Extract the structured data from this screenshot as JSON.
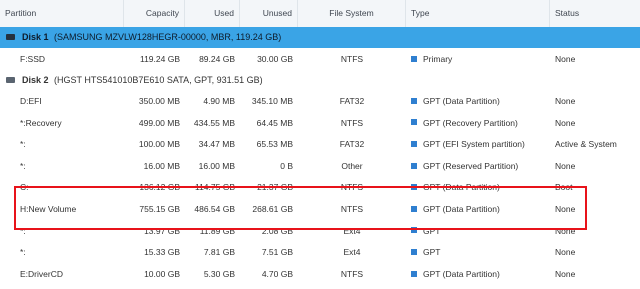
{
  "columns": {
    "partition": "Partition",
    "capacity": "Capacity",
    "used": "Used",
    "unused": "Unused",
    "filesystem": "File System",
    "type": "Type",
    "status": "Status"
  },
  "disk1": {
    "name": "Disk 1",
    "info": "(SAMSUNG MZVLW128HEGR-00000, MBR, 119.24 GB)",
    "rows": [
      {
        "partition": "F:SSD",
        "capacity": "119.24 GB",
        "used": "89.24 GB",
        "unused": "30.00 GB",
        "fs": "NTFS",
        "type": "Primary",
        "status": "None"
      }
    ]
  },
  "disk2": {
    "name": "Disk 2",
    "info": "(HGST HTS541010B7E610 SATA, GPT, 931.51 GB)",
    "rows": [
      {
        "partition": "D:EFI",
        "capacity": "350.00 MB",
        "used": "4.90 MB",
        "unused": "345.10 MB",
        "fs": "FAT32",
        "type": "GPT (Data Partition)",
        "status": "None"
      },
      {
        "partition": "*:Recovery",
        "capacity": "499.00 MB",
        "used": "434.55 MB",
        "unused": "64.45 MB",
        "fs": "NTFS",
        "type": "GPT (Recovery Partition)",
        "status": "None"
      },
      {
        "partition": "*:",
        "capacity": "100.00 MB",
        "used": "34.47 MB",
        "unused": "65.53 MB",
        "fs": "FAT32",
        "type": "GPT (EFI System partition)",
        "status": "Active & System"
      },
      {
        "partition": "*:",
        "capacity": "16.00 MB",
        "used": "16.00 MB",
        "unused": "0 B",
        "fs": "Other",
        "type": "GPT (Reserved Partition)",
        "status": "None"
      },
      {
        "partition": "C:",
        "capacity": "136.12 GB",
        "used": "114.75 GB",
        "unused": "21.37 GB",
        "fs": "NTFS",
        "type": "GPT (Data Partition)",
        "status": "Boot"
      },
      {
        "partition": "H:New Volume",
        "capacity": "755.15 GB",
        "used": "486.54 GB",
        "unused": "268.61 GB",
        "fs": "NTFS",
        "type": "GPT (Data Partition)",
        "status": "None"
      },
      {
        "partition": "*:",
        "capacity": "13.97 GB",
        "used": "11.89 GB",
        "unused": "2.08 GB",
        "fs": "Ext4",
        "type": "GPT",
        "status": "None"
      },
      {
        "partition": "*:",
        "capacity": "15.33 GB",
        "used": "7.81 GB",
        "unused": "7.51 GB",
        "fs": "Ext4",
        "type": "GPT",
        "status": "None"
      },
      {
        "partition": "E:DriverCD",
        "capacity": "10.00 GB",
        "used": "5.30 GB",
        "unused": "4.70 GB",
        "fs": "NTFS",
        "type": "GPT (Data Partition)",
        "status": "None"
      }
    ]
  }
}
